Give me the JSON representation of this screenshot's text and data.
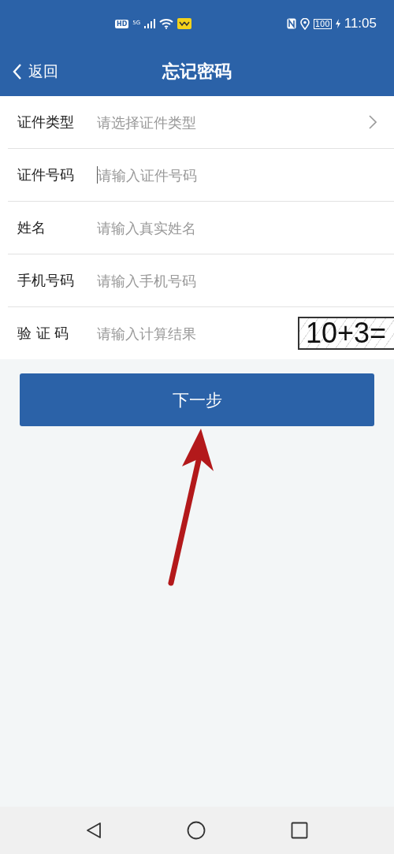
{
  "status_bar": {
    "left_badges": [
      "HD",
      "5G"
    ],
    "battery": "100",
    "time": "11:05"
  },
  "header": {
    "back": "返回",
    "title": "忘记密码"
  },
  "form": [
    {
      "kind": "select",
      "label": "证件类型",
      "placeholder": "请选择证件类型",
      "focused": false
    },
    {
      "kind": "input",
      "label": "证件号码",
      "placeholder": "请输入证件号码",
      "focused": true
    },
    {
      "kind": "input",
      "label": "姓名",
      "placeholder": "请输入真实姓名",
      "focused": false
    },
    {
      "kind": "input",
      "label": "手机号码",
      "placeholder": "请输入手机号码",
      "focused": false
    },
    {
      "kind": "captcha",
      "label": "验 证 码",
      "placeholder": "请输入计算结果",
      "focused": false,
      "captcha": "10+3="
    }
  ],
  "next_button": "下一步",
  "annotation": {
    "kind": "arrow"
  }
}
